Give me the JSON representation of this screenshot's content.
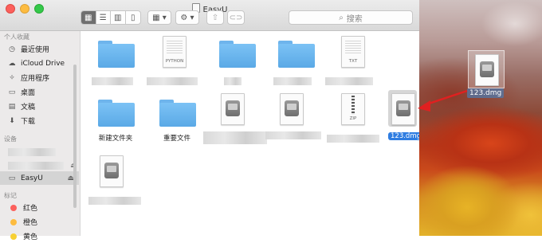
{
  "window": {
    "title": "EasyU",
    "search_placeholder": "搜索",
    "colors": {
      "close": "#fc605c",
      "minimize": "#fdbc40",
      "maximize": "#34c84a",
      "selection": "#2f7de1",
      "folder": "#6bb6f0"
    }
  },
  "toolbar": {
    "back_icon": "chevron-left-icon",
    "forward_icon": "chevron-right-icon",
    "view_icons": [
      "icon-view-icon",
      "list-view-icon",
      "column-view-icon",
      "coverflow-view-icon"
    ],
    "arrange_icon": "grid-arrange-icon",
    "action_icon": "gear-icon",
    "share_icon": "share-icon",
    "tag_icon": "tag-icon"
  },
  "sidebar": {
    "favorites_header": "个人收藏",
    "favorites": [
      {
        "label": "最近使用",
        "icon": "clock-icon"
      },
      {
        "label": "iCloud Drive",
        "icon": "cloud-icon"
      },
      {
        "label": "应用程序",
        "icon": "applications-icon"
      },
      {
        "label": "桌面",
        "icon": "desktop-icon"
      },
      {
        "label": "文稿",
        "icon": "document-icon"
      },
      {
        "label": "下载",
        "icon": "download-icon"
      }
    ],
    "devices_header": "设备",
    "devices": [
      {
        "label": "EasyU",
        "icon": "disk-icon",
        "selected": true
      }
    ],
    "tags_header": "标记",
    "tags": [
      {
        "label": "红色",
        "color": "#fc605c"
      },
      {
        "label": "橙色",
        "color": "#fdbc40"
      },
      {
        "label": "黄色",
        "color": "#f7d033"
      }
    ]
  },
  "files": [
    {
      "type": "folder",
      "label": ""
    },
    {
      "type": "doc",
      "kind": "PYTHON",
      "label": ""
    },
    {
      "type": "folder",
      "label": ""
    },
    {
      "type": "folder",
      "label": ""
    },
    {
      "type": "doc",
      "kind": "TXT",
      "label": ""
    },
    {
      "type": "folder",
      "label": "新建文件夹"
    },
    {
      "type": "folder",
      "label": "重要文件"
    },
    {
      "type": "dmg",
      "label": ""
    },
    {
      "type": "dmg",
      "label": ""
    },
    {
      "type": "zip",
      "kind": "ZIP",
      "label": ""
    },
    {
      "type": "dmg",
      "label": "123.dmg",
      "selected": true
    },
    {
      "type": "dmg",
      "label": ""
    }
  ],
  "desktop": {
    "dragged_file_label": "123.dmg"
  }
}
